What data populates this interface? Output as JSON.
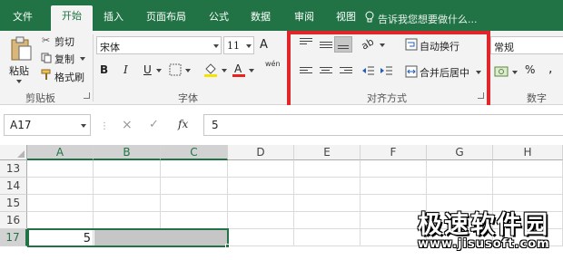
{
  "tabs": [
    "文件",
    "开始",
    "插入",
    "页面布局",
    "公式",
    "数据",
    "审阅",
    "视图"
  ],
  "tell_me": "告诉我您想要做什么...",
  "clipboard": {
    "paste": "粘贴",
    "cut": "剪切",
    "copy": "复制",
    "format_painter": "格式刷",
    "label": "剪贴板"
  },
  "font": {
    "name": "宋体",
    "size": "11",
    "bold": "B",
    "italic": "I",
    "underline": "U",
    "label": "字体",
    "phonetic": "wén",
    "font_color": "#e8221c",
    "fill_color": "#f5e300"
  },
  "alignment": {
    "wrap_text": "自动换行",
    "merge_center": "合并后居中",
    "label": "对齐方式"
  },
  "number": {
    "format": "常规",
    "percent": "%",
    "comma": ",",
    "label": "数字"
  },
  "formula_bar": {
    "name_box": "A17",
    "cancel": "×",
    "enter": "✓",
    "fx": "fx",
    "value": "5"
  },
  "columns": [
    "A",
    "B",
    "C",
    "D",
    "E",
    "F",
    "G",
    "H"
  ],
  "rows": [
    "13",
    "14",
    "15",
    "16",
    "17"
  ],
  "cell_a17": "5",
  "watermark": {
    "title": "极速软件园",
    "url": "www.jisusoft.com"
  },
  "colors": {
    "brand": "#217346",
    "highlight": "#e0262b"
  }
}
